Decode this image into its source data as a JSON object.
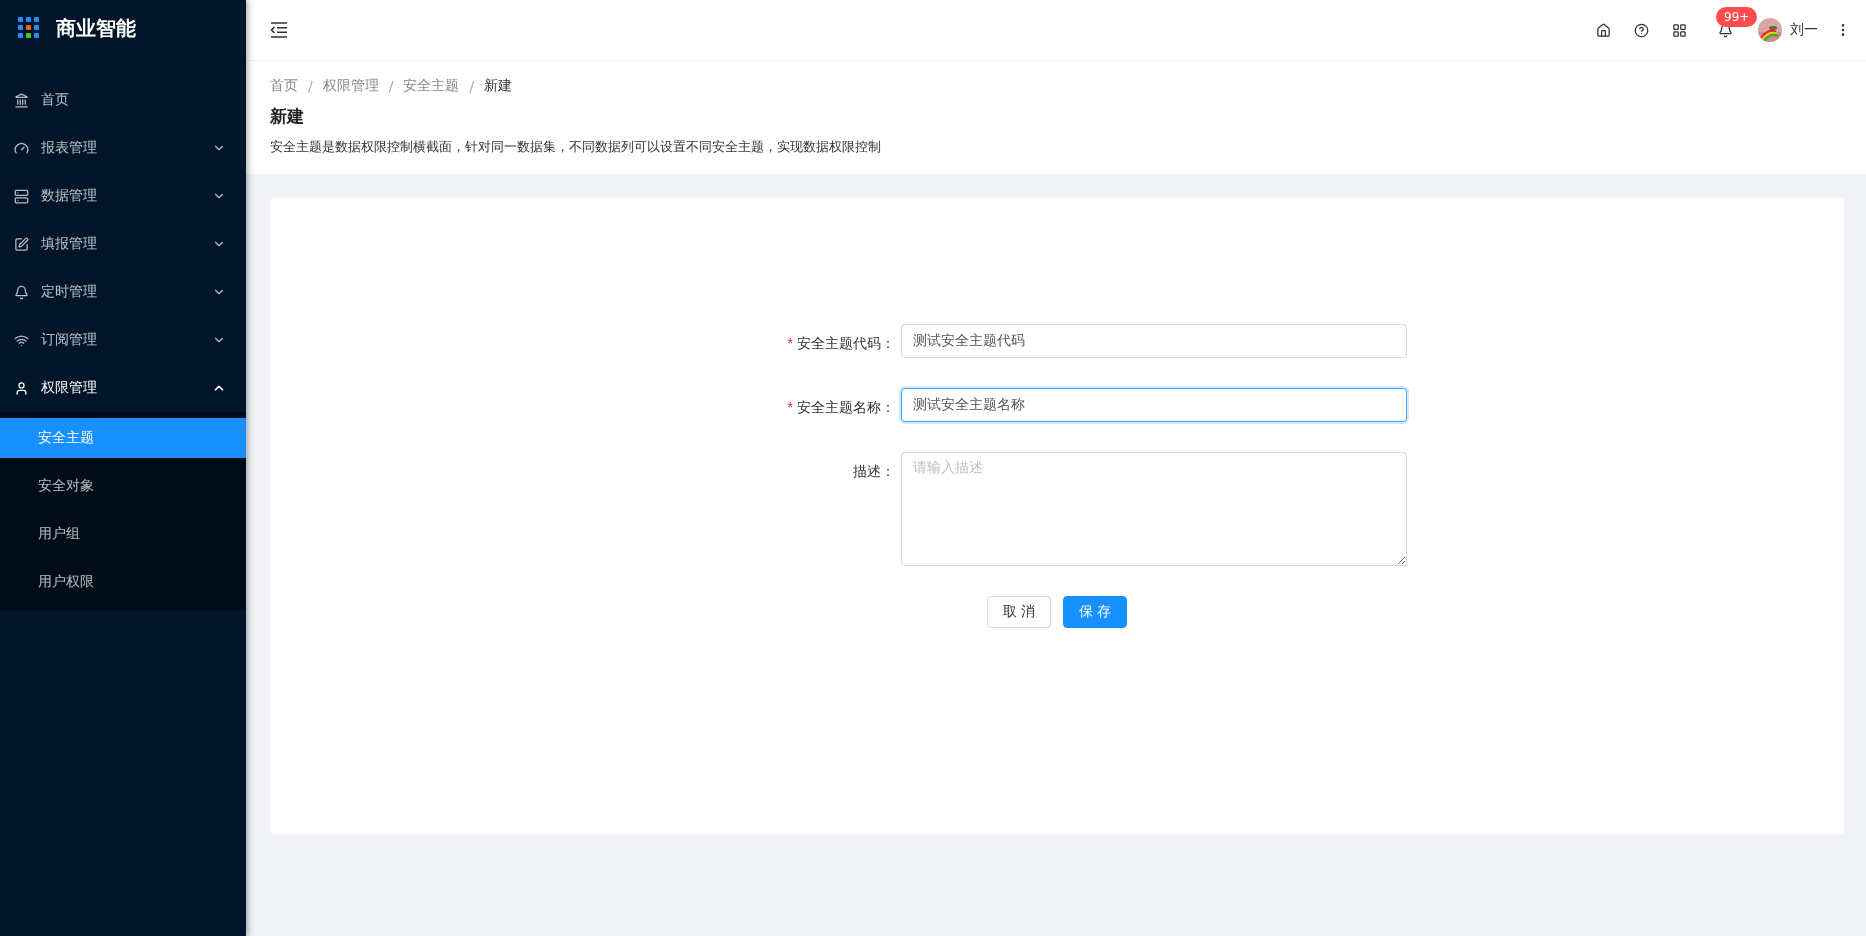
{
  "app": {
    "title": "商业智能"
  },
  "sidebar": {
    "items": [
      {
        "label": "首页"
      },
      {
        "label": "报表管理",
        "expanded": false
      },
      {
        "label": "数据管理",
        "expanded": false
      },
      {
        "label": "填报管理",
        "expanded": false
      },
      {
        "label": "定时管理",
        "expanded": false
      },
      {
        "label": "订阅管理",
        "expanded": false
      },
      {
        "label": "权限管理",
        "expanded": true,
        "children": [
          {
            "label": "安全主题",
            "selected": true
          },
          {
            "label": "安全对象",
            "selected": false
          },
          {
            "label": "用户组",
            "selected": false
          },
          {
            "label": "用户权限",
            "selected": false
          }
        ]
      }
    ]
  },
  "header": {
    "notification_badge": "99+",
    "user": {
      "name": "刘一"
    }
  },
  "breadcrumb": [
    {
      "label": "首页",
      "separator": "/"
    },
    {
      "label": "权限管理",
      "separator": "/"
    },
    {
      "label": "安全主题",
      "separator": "/"
    },
    {
      "label": "新建"
    }
  ],
  "page": {
    "title": "新建",
    "description": "安全主题是数据权限控制横截面，针对同一数据集，不同数据列可以设置不同安全主题，实现数据权限控制"
  },
  "form": {
    "fields": [
      {
        "kind": "input",
        "label": "安全主题代码：",
        "required_mark": "*",
        "value": "测试安全主题代码",
        "focused": false
      },
      {
        "kind": "input",
        "label": "安全主题名称：",
        "required_mark": "*",
        "value": "测试安全主题名称",
        "focused": true
      },
      {
        "kind": "textarea",
        "label": "描述：",
        "placeholder": "请输入描述",
        "focused": false
      }
    ],
    "buttons": [
      {
        "label": "取 消",
        "primary": false
      },
      {
        "label": "保 存",
        "primary": true
      }
    ]
  }
}
